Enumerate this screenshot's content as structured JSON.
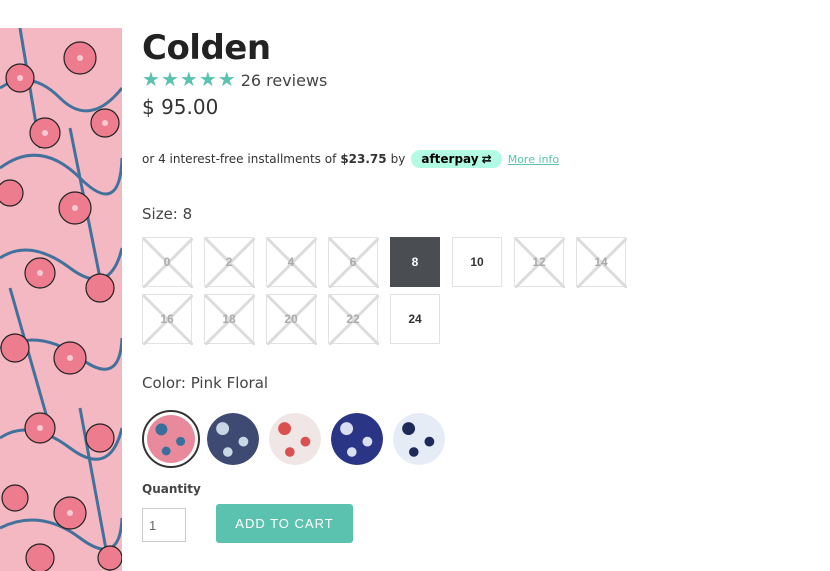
{
  "product": {
    "title": "Colden",
    "rating_stars": 5,
    "reviews_text": "26 reviews",
    "price": "$ 95.00",
    "afterpay": {
      "prefix": "or 4 interest-free installments of",
      "amount": "$23.75",
      "suffix": "by",
      "badge": "afterpay",
      "more_info": "More info"
    }
  },
  "size": {
    "label": "Size: 8",
    "options": [
      {
        "value": "0",
        "available": false,
        "selected": false
      },
      {
        "value": "2",
        "available": false,
        "selected": false
      },
      {
        "value": "4",
        "available": false,
        "selected": false
      },
      {
        "value": "6",
        "available": false,
        "selected": false
      },
      {
        "value": "8",
        "available": true,
        "selected": true
      },
      {
        "value": "10",
        "available": true,
        "selected": false
      },
      {
        "value": "12",
        "available": false,
        "selected": false
      },
      {
        "value": "14",
        "available": false,
        "selected": false
      },
      {
        "value": "16",
        "available": false,
        "selected": false
      },
      {
        "value": "18",
        "available": false,
        "selected": false
      },
      {
        "value": "20",
        "available": false,
        "selected": false
      },
      {
        "value": "22",
        "available": false,
        "selected": false
      },
      {
        "value": "24",
        "available": true,
        "selected": false
      }
    ]
  },
  "color": {
    "label": "Color: Pink Floral",
    "swatches": [
      {
        "name": "pink-floral",
        "selected": true,
        "bg": "#e98a9c",
        "accent": "#3a6f9b"
      },
      {
        "name": "navy-floral",
        "selected": false,
        "bg": "#3f4a72",
        "accent": "#c8d6e6"
      },
      {
        "name": "white-red-floral",
        "selected": false,
        "bg": "#f1e6e6",
        "accent": "#d9504f"
      },
      {
        "name": "navy-print",
        "selected": false,
        "bg": "#2b3585",
        "accent": "#d8dff0"
      },
      {
        "name": "white-shark",
        "selected": false,
        "bg": "#e6ecf6",
        "accent": "#1e2b5a"
      }
    ]
  },
  "quantity": {
    "label": "Quantity",
    "value": "1"
  },
  "cart": {
    "button_label": "ADD TO CART"
  },
  "colors": {
    "accent": "#5cc2b0",
    "selected_size_bg": "#4a4d52",
    "afterpay_badge": "#b2fce4"
  }
}
